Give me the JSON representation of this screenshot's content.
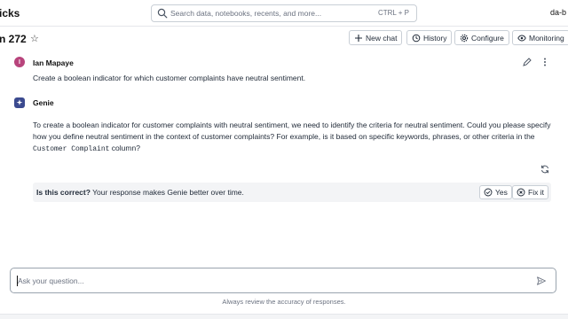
{
  "header": {
    "brand": "icks",
    "search_placeholder": "Search data, notebooks, recents, and more...",
    "search_shortcut": "CTRL + P",
    "workspace": "da-b"
  },
  "space": {
    "title": "n 272",
    "buttons": {
      "new_chat": "New chat",
      "history": "History",
      "configure": "Configure",
      "monitoring": "Monitoring"
    }
  },
  "conversation": {
    "user": {
      "initial": "I",
      "name": "Ian Mapaye",
      "text": "Create a boolean indicator for which customer complaints have neutral sentiment."
    },
    "genie": {
      "name": "Genie",
      "text_part1": "To create a boolean indicator for customer complaints with neutral sentiment, we need to identify the criteria for neutral sentiment. Could you please specify how you define neutral sentiment in the context of customer complaints? For example, is it based on specific keywords, phrases, or other criteria in the",
      "code": "Customer Complaint",
      "text_part2": "column?"
    }
  },
  "feedback": {
    "question": "Is this correct?",
    "prompt": "Your response makes Genie better over time.",
    "yes": "Yes",
    "fix": "Fix it"
  },
  "input": {
    "placeholder": "Ask your question...",
    "disclaimer": "Always review the accuracy of responses."
  },
  "colors": {
    "user_avatar": "#b8447c",
    "genie_avatar": "#3b4a8f",
    "feedback_bg": "#f3f4f6"
  }
}
